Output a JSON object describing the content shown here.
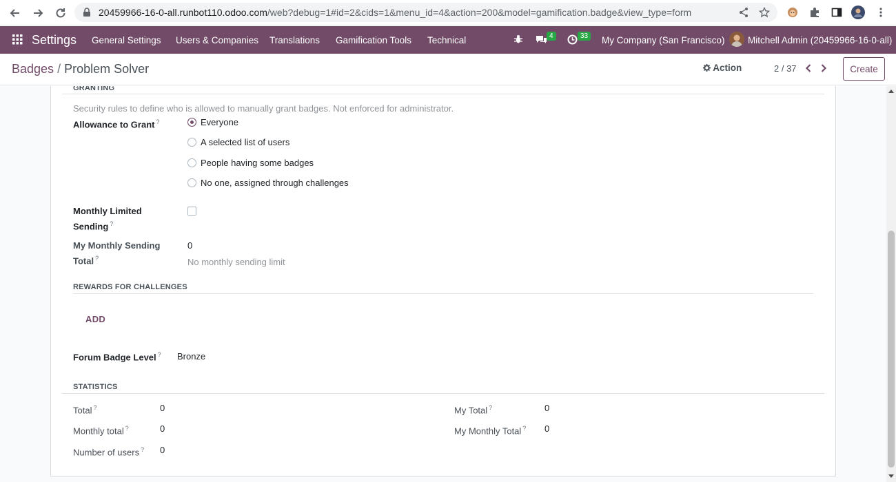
{
  "browser": {
    "url_host": "20459966-16-0-all.runbot110.odoo.com",
    "url_path": "/web?debug=1#id=2&cids=1&menu_id=4&action=200&model=gamification.badge&view_type=form"
  },
  "navbar": {
    "app_name": "Settings",
    "menu": [
      "General Settings",
      "Users & Companies",
      "Translations",
      "Gamification Tools",
      "Technical"
    ],
    "messages_count": "4",
    "activities_count": "33",
    "company": "My Company (San Francisco)",
    "user": "Mitchell Admin (20459966-16-0-all)"
  },
  "control_panel": {
    "breadcrumb_parent": "Badges",
    "breadcrumb_sep": "/",
    "breadcrumb_current": "Problem Solver",
    "action_label": "Action",
    "pager": "2 / 37",
    "create_label": "Create"
  },
  "granting": {
    "title": "GRANTING",
    "help": "Security rules to define who is allowed to manually grant badges. Not enforced for administrator.",
    "allowance_label": "Allowance to Grant",
    "options": [
      "Everyone",
      "A selected list of users",
      "People having some badges",
      "No one, assigned through challenges"
    ],
    "selected": "Everyone",
    "monthly_limited_label_1": "Monthly Limited",
    "monthly_limited_label_2": "Sending",
    "monthly_limited_checked": false,
    "my_monthly_label_1": "My Monthly Sending",
    "my_monthly_label_2": "Total",
    "my_monthly_value": "0",
    "my_monthly_hint": "No monthly sending limit"
  },
  "rewards": {
    "title": "REWARDS FOR CHALLENGES",
    "add_label": "ADD",
    "forum_level_label": "Forum Badge Level",
    "forum_level_value": "Bronze"
  },
  "statistics": {
    "title": "STATISTICS",
    "total_label": "Total",
    "total_value": "0",
    "monthly_total_label": "Monthly total",
    "monthly_total_value": "0",
    "num_users_label": "Number of users",
    "num_users_value": "0",
    "my_total_label": "My Total",
    "my_total_value": "0",
    "my_monthly_total_label": "My Monthly Total",
    "my_monthly_total_value": "0"
  },
  "help_mark": "?",
  "colors": {
    "brand": "#714b67",
    "badge": "#28a745"
  }
}
